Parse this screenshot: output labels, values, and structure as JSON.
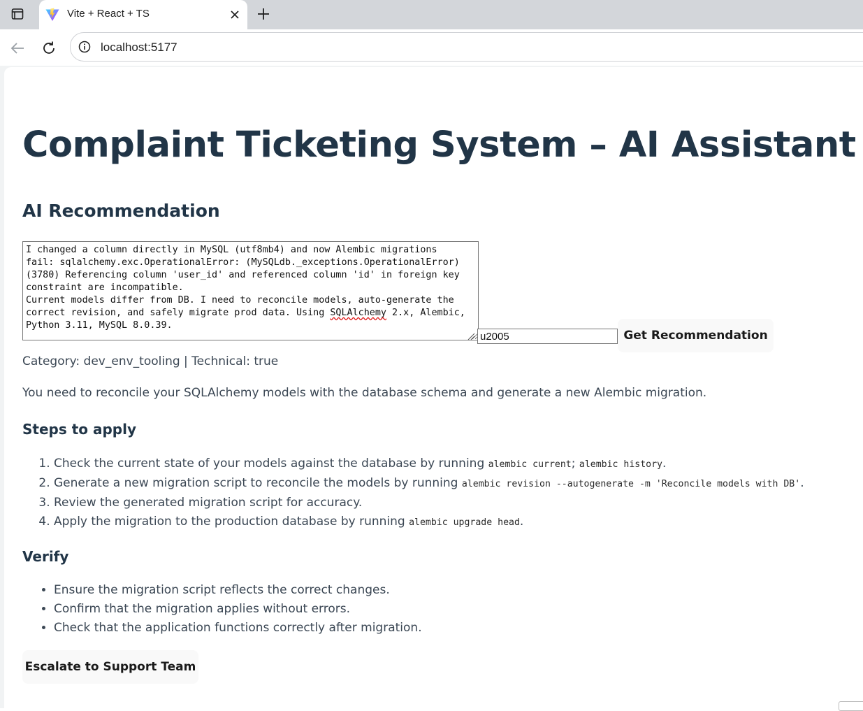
{
  "browser": {
    "tab_title": "Vite + React + TS",
    "url": "localhost:5177"
  },
  "page": {
    "title": "Complaint Ticketing System – AI Assistant",
    "section_title": "AI Recommendation",
    "question_lines": [
      "I changed a column directly in MySQL (utf8mb4) and now Alembic migrations",
      "fail: sqlalchemy.exc.OperationalError: (MySQLdb._exceptions.OperationalError)",
      "(3780) Referencing column 'user_id' and referenced column 'id' in foreign key",
      "constraint are incompatible.",
      "Current models differ from DB. I need to reconcile models, auto-generate the",
      "correct revision, and safely migrate prod data. Using ",
      "SQLAlchemy",
      " 2.x, Alembic,",
      "Python 3.11, MySQL 8.0.39."
    ],
    "user_id_value": "u2005",
    "get_recommendation_label": "Get Recommendation",
    "meta": "Category: dev_env_tooling | Technical: true",
    "summary": "You need to reconcile your SQLAlchemy models with the database schema and generate a new Alembic migration.",
    "steps_title": "Steps to apply",
    "steps": [
      {
        "text": "Check the current state of your models against the database by running ",
        "code1": "alembic current",
        "sep": "; ",
        "code2": "alembic history",
        "end": "."
      },
      {
        "text": "Generate a new migration script to reconcile the models by running ",
        "code1": "alembic revision --autogenerate -m 'Reconcile models with DB'",
        "end": "."
      },
      {
        "text": "Review the generated migration script for accuracy."
      },
      {
        "text": "Apply the migration to the production database by running ",
        "code1": "alembic upgrade head",
        "end": "."
      }
    ],
    "verify_title": "Verify",
    "verify_items": [
      "Ensure the migration script reflects the correct changes.",
      "Confirm that the migration applies without errors.",
      "Check that the application functions correctly after migration."
    ],
    "escalate_label": "Escalate to Support Team"
  },
  "colors": {
    "heading": "#213547",
    "body_text": "#3b4754",
    "button_bg": "#f9f9f9",
    "tabbar_bg": "#d3d6da"
  },
  "icons": [
    "tab-strip-icon",
    "vite-favicon-icon",
    "close-icon",
    "plus-icon",
    "back-arrow-icon",
    "reload-icon",
    "site-info-icon",
    "resize-grip-icon"
  ]
}
